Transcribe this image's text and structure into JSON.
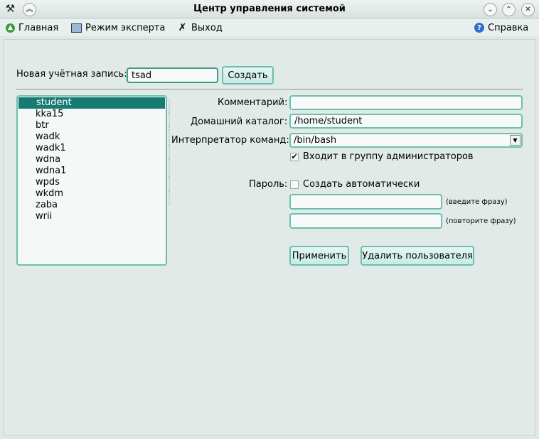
{
  "window": {
    "title": "Центр управления системой"
  },
  "menu": {
    "home": "Главная",
    "expert": "Режим эксперта",
    "exit": "Выход",
    "help": "Справка"
  },
  "new_account": {
    "label": "Новая учётная запись:",
    "value": "tsad",
    "create_button": "Создать"
  },
  "users": [
    "student",
    "kka15",
    "btr",
    "wadk",
    "wadk1",
    "wdna",
    "wdna1",
    "wpds",
    "wkdm",
    "zaba",
    "wrii"
  ],
  "selected_user": "student",
  "form": {
    "comment_label": "Комментарий:",
    "comment_value": "",
    "home_label": "Домашний каталог:",
    "home_value": "/home/student",
    "shell_label": "Интерпретатор команд:",
    "shell_value": "/bin/bash",
    "admin_group_label": "Входит в группу администраторов",
    "admin_group_checked": true,
    "password_label": "Пароль:",
    "auto_password_label": "Создать автоматически",
    "auto_password_checked": false,
    "enter_phrase_hint": "(введите фразу)",
    "repeat_phrase_hint": "(повторите фразу)",
    "apply_button": "Применить",
    "delete_button": "Удалить пользователя"
  }
}
